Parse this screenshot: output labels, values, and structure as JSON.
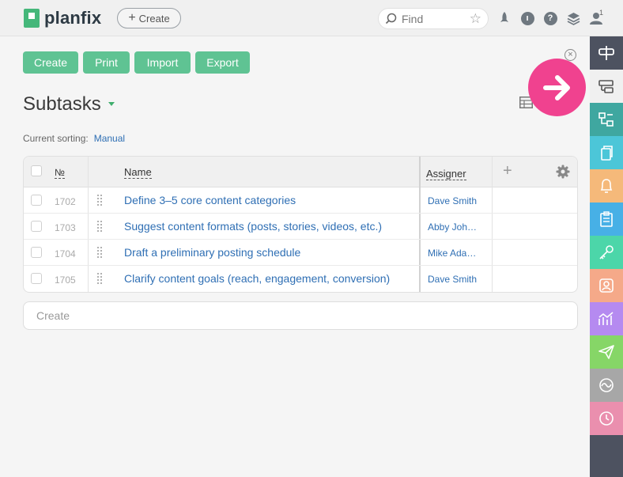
{
  "app": {
    "logo_text": "planfix",
    "create_label": "Create",
    "search_placeholder": "Find",
    "notification_count": "1"
  },
  "toolbar": {
    "create": "Create",
    "print": "Print",
    "import": "Import",
    "export": "Export"
  },
  "page": {
    "title": "Subtasks",
    "sorting_label": "Current sorting:",
    "sorting_value": "Manual"
  },
  "table": {
    "columns": {
      "number": "№",
      "name": "Name",
      "assigner": "Assigner"
    },
    "rows": [
      {
        "num": "1702",
        "name": "Define 3–5 core content categories",
        "assigner": "Dave Smith"
      },
      {
        "num": "1703",
        "name": "Suggest content formats (posts, stories, videos, etc.)",
        "assigner": "Abby Joh…"
      },
      {
        "num": "1704",
        "name": "Draft a preliminary posting schedule",
        "assigner": "Mike Ada…"
      },
      {
        "num": "1705",
        "name": "Clarify content goals (reach, engagement, conversion)",
        "assigner": "Dave Smith"
      }
    ]
  },
  "create_placeholder": "Create",
  "sidebar": {
    "items": [
      {
        "icon": "signpost-icon",
        "color": "#4d5260"
      },
      {
        "icon": "subtasks-icon",
        "color": "#f0f0f0"
      },
      {
        "icon": "hierarchy-icon",
        "color": "#3fa7a0"
      },
      {
        "icon": "documents-icon",
        "color": "#4cc6d8"
      },
      {
        "icon": "bell-icon",
        "color": "#f5b97a"
      },
      {
        "icon": "checklist-icon",
        "color": "#47b0e6"
      },
      {
        "icon": "key-icon",
        "color": "#4cd6a9"
      },
      {
        "icon": "contact-icon",
        "color": "#f5a989"
      },
      {
        "icon": "analytics-icon",
        "color": "#b58af0"
      },
      {
        "icon": "send-icon",
        "color": "#86d667"
      },
      {
        "icon": "wave-icon",
        "color": "#a7a7a7"
      },
      {
        "icon": "clock-icon",
        "color": "#ea8fae"
      }
    ]
  },
  "colors": {
    "accent_green": "#5fc393",
    "link_blue": "#2f6fb4",
    "pink": "#f0428f"
  }
}
